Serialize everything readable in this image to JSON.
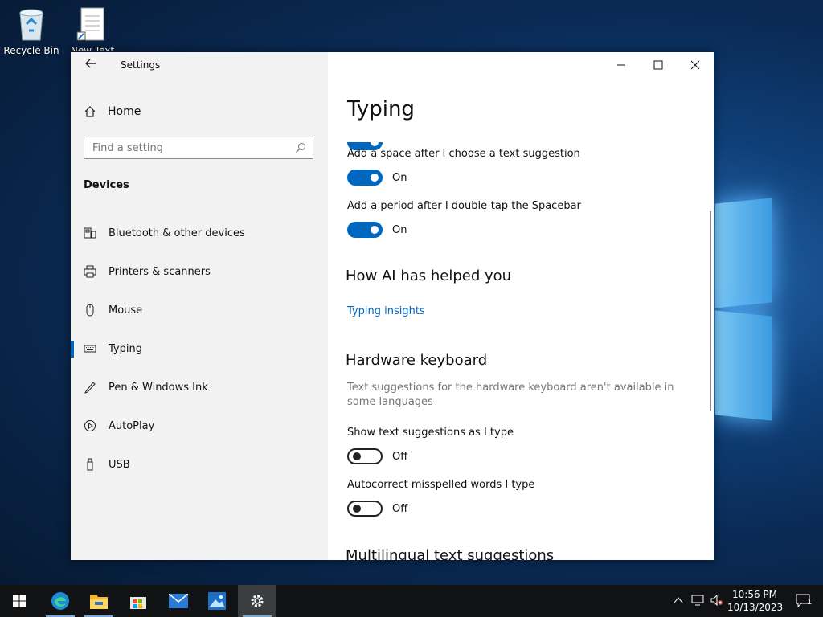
{
  "desktop": {
    "icons": [
      {
        "label": "Recycle Bin"
      },
      {
        "label": "New Text"
      }
    ]
  },
  "window": {
    "app_title": "Settings",
    "back_icon": "back-arrow-icon",
    "controls": {
      "minimize": "minimize-icon",
      "maximize": "maximize-icon",
      "close": "close-icon"
    }
  },
  "sidebar": {
    "home_label": "Home",
    "search_placeholder": "Find a setting",
    "section": "Devices",
    "items": [
      {
        "label": "Bluetooth & other devices",
        "icon": "bluetooth-devices-icon"
      },
      {
        "label": "Printers & scanners",
        "icon": "printer-icon"
      },
      {
        "label": "Mouse",
        "icon": "mouse-icon"
      },
      {
        "label": "Typing",
        "icon": "keyboard-icon",
        "active": true
      },
      {
        "label": "Pen & Windows Ink",
        "icon": "pen-icon"
      },
      {
        "label": "AutoPlay",
        "icon": "autoplay-icon"
      },
      {
        "label": "USB",
        "icon": "usb-icon"
      }
    ]
  },
  "content": {
    "title": "Typing",
    "settings": [
      {
        "label": "Add a space after I choose a text suggestion",
        "state": "On"
      },
      {
        "label": "Add a period after I double-tap the Spacebar",
        "state": "On"
      }
    ],
    "ai_section": {
      "heading": "How AI has helped you",
      "link": "Typing insights"
    },
    "hardware": {
      "heading": "Hardware keyboard",
      "description": "Text suggestions for the hardware keyboard aren't available in some languages",
      "settings": [
        {
          "label": "Show text suggestions as I type",
          "state": "Off"
        },
        {
          "label": "Autocorrect misspelled words I type",
          "state": "Off"
        }
      ]
    },
    "next_heading": "Multilingual text suggestions"
  },
  "taskbar": {
    "apps": [
      "start-icon",
      "edge-icon",
      "file-explorer-icon",
      "store-icon",
      "mail-icon",
      "photos-icon",
      "settings-icon"
    ],
    "clock_time": "10:56 PM",
    "clock_date": "10/13/2023",
    "notification_count": "1",
    "accent": "#0067c0"
  }
}
